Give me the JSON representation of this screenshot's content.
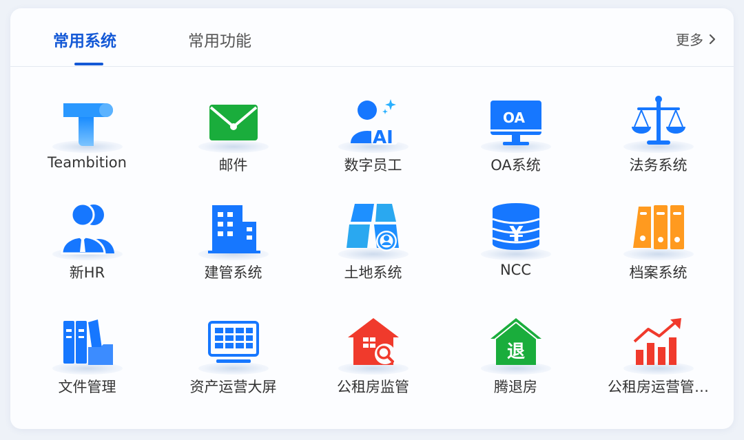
{
  "tabs": [
    {
      "label": "常用系统",
      "active": true
    },
    {
      "label": "常用功能",
      "active": false
    }
  ],
  "more": {
    "label": "更多"
  },
  "colors": {
    "accent": "#1459d6",
    "blue": "#1677ff",
    "green": "#1aad3c",
    "red": "#f03a2c",
    "orange": "#ff9a1f"
  },
  "items": [
    {
      "label": "Teambition",
      "icon": "teambition-icon"
    },
    {
      "label": "邮件",
      "icon": "mail-icon"
    },
    {
      "label": "数字员工",
      "icon": "ai-person-icon"
    },
    {
      "label": "OA系统",
      "icon": "oa-monitor-icon"
    },
    {
      "label": "法务系统",
      "icon": "scales-icon"
    },
    {
      "label": "新HR",
      "icon": "hr-people-icon"
    },
    {
      "label": "建管系统",
      "icon": "building-icon"
    },
    {
      "label": "土地系统",
      "icon": "land-map-icon"
    },
    {
      "label": "NCC",
      "icon": "coins-icon"
    },
    {
      "label": "档案系统",
      "icon": "binders-icon"
    },
    {
      "label": "文件管理",
      "icon": "files-icon"
    },
    {
      "label": "资产运营大屏",
      "icon": "big-screen-icon"
    },
    {
      "label": "公租房监管",
      "icon": "house-search-icon"
    },
    {
      "label": "腾退房",
      "icon": "house-vacate-icon",
      "glyph": "退"
    },
    {
      "label": "公租房运营管…",
      "icon": "growth-chart-icon"
    }
  ]
}
